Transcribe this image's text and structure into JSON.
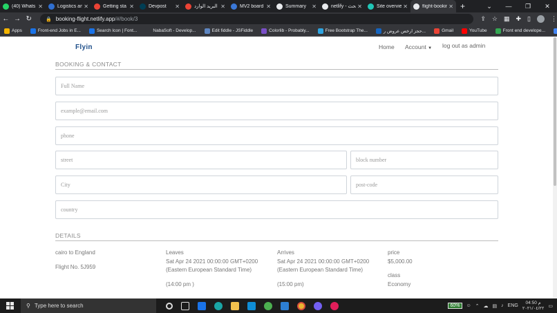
{
  "browser": {
    "tabs": [
      {
        "label": "(40) Whats",
        "icon": "whatsapp-icon",
        "color": "#25d366"
      },
      {
        "label": "Logistics an",
        "icon": "logistics-icon",
        "color": "#2f6fd1"
      },
      {
        "label": "Getting sta",
        "icon": "gmail-icon",
        "color": "#ea4335"
      },
      {
        "label": "Devpost",
        "icon": "devpost-icon",
        "color": "#003e54"
      },
      {
        "label": "البريد الوارد",
        "icon": "gmail-icon",
        "color": "#ea4335"
      },
      {
        "label": "MV2 board",
        "icon": "board-icon",
        "color": "#3a78d8"
      },
      {
        "label": "Summary",
        "icon": "github-icon",
        "color": "#e8eaed"
      },
      {
        "label": "netlify - بحث",
        "icon": "google-icon",
        "color": "#e8eaed"
      },
      {
        "label": "Site overvie",
        "icon": "netlify-icon",
        "color": "#20c6b7"
      },
      {
        "label": "flight-bookin",
        "icon": "page-icon",
        "color": "#e8eaed"
      }
    ],
    "url_host": "booking-flight.netlify.app",
    "url_path": "/#/book/3",
    "bookmarks": [
      {
        "label": "Apps",
        "color": "#f4b400"
      },
      {
        "label": "Front-end Jobs in E...",
        "color": "#1a73e8"
      },
      {
        "label": "Search Icon | Font...",
        "color": "#1a73e8"
      },
      {
        "label": "NabaSoft - Develop...",
        "color": "#35363a"
      },
      {
        "label": "Edit fiddle - JSFiddle",
        "color": "#5e86c1"
      },
      {
        "label": "Colorlib - Probably...",
        "color": "#7a4fc7"
      },
      {
        "label": "Free Bootstrap The...",
        "color": "#2ea4e0"
      },
      {
        "label": "حجز ارخص عروض ر...",
        "color": "#1565c0"
      },
      {
        "label": "Gmail",
        "color": "#ea4335"
      },
      {
        "label": "YouTube",
        "color": "#ff0000"
      },
      {
        "label": "Front end develope...",
        "color": "#34a853"
      },
      {
        "label": "Maps",
        "color": "#4285f4"
      }
    ]
  },
  "site": {
    "brand": "Flyin",
    "nav": {
      "home": "Home",
      "account": "Account",
      "logout": "log out as admin"
    }
  },
  "booking": {
    "section_title": "BOOKING & CONTACT",
    "placeholders": {
      "full_name": "Full Name",
      "email": "example@email.com",
      "phone": "phone",
      "street": "street",
      "block": "block number",
      "city": "City",
      "postcode": "post-code",
      "country": "country"
    }
  },
  "details": {
    "section_title": "DETAILS",
    "route": "cairo to England",
    "flight_no": "Flight No. 5J959",
    "leaves_label": "Leaves",
    "leaves_date": "Sat Apr 24 2021 00:00:00 GMT+0200",
    "leaves_tz": "(Eastern European Standard Time)",
    "leaves_time": "(14:00 pm )",
    "arrives_label": "Arrives",
    "arrives_date": "Sat Apr 24 2021 00:00:00 GMT+0200",
    "arrives_tz": "(Eastern European Standard Time)",
    "arrives_time": "(15:00 pm)",
    "price_label": "price",
    "price": "$5,000.00",
    "class_label": "class",
    "class_value": "Economy"
  },
  "taskbar": {
    "search_placeholder": "Type here to search",
    "battery": "60%",
    "language": "ENG",
    "time": "04:50 م",
    "date": "٢٠٢١/٠٤/٢٢"
  }
}
